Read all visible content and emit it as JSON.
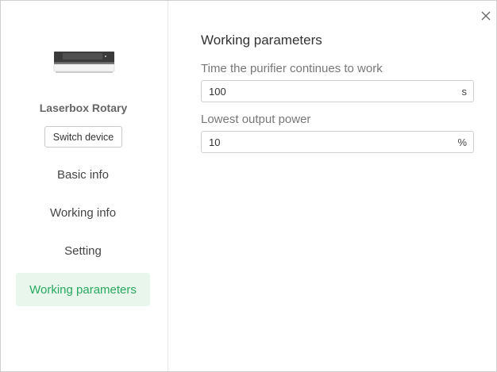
{
  "device": {
    "name": "Laserbox Rotary",
    "switch_label": "Switch device",
    "image_icon": "laser-engraver-device-icon"
  },
  "sidebar": {
    "items": [
      {
        "label": "Basic info",
        "active": false
      },
      {
        "label": "Working info",
        "active": false
      },
      {
        "label": "Setting",
        "active": false
      },
      {
        "label": "Working parameters",
        "active": true
      }
    ]
  },
  "main": {
    "title": "Working parameters",
    "fields": [
      {
        "label": "Time the purifier continues to work",
        "value": "100",
        "unit": "s"
      },
      {
        "label": "Lowest output power",
        "value": "10",
        "unit": "%"
      }
    ]
  },
  "colors": {
    "accent": "#2aa860",
    "active_background": "#e8f6ec"
  },
  "icons": {
    "close": "close-icon"
  }
}
